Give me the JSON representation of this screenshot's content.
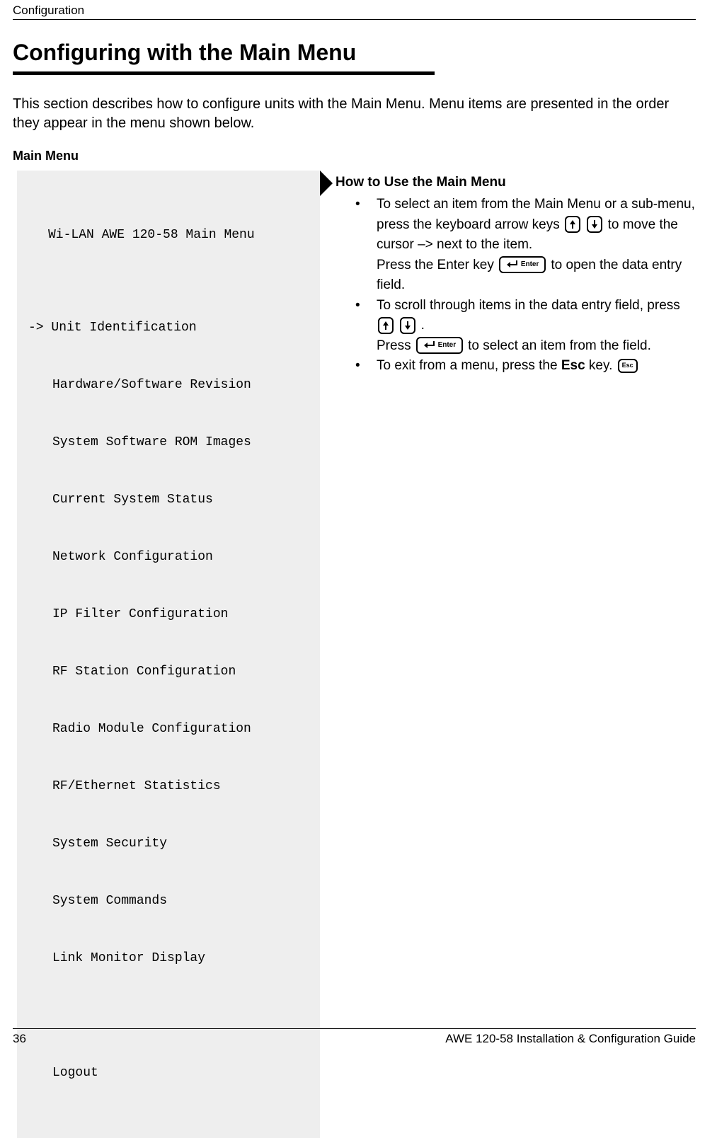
{
  "header": {
    "running": "Configuration"
  },
  "title": "Configuring with the Main Menu",
  "intro": "This section describes how to configure units with the Main Menu. Menu items are presented in the order they appear in the menu shown below.",
  "subhead": "Main Menu",
  "menu": {
    "title": "Wi-LAN AWE 120-58 Main Menu",
    "selected_index": 0,
    "items": [
      "Unit Identification",
      "Hardware/Software Revision",
      "System Software ROM Images",
      "Current System Status",
      "Network Configuration",
      "IP Filter Configuration",
      "RF Station Configuration",
      "Radio Module Configuration",
      "RF/Ethernet Statistics",
      "System Security",
      "System Commands",
      "Link Monitor Display"
    ],
    "logout": "Logout"
  },
  "howto": {
    "heading": "How to Use the Main Menu",
    "b1_a": "To select an item from the Main Menu or a sub-menu, press the keyboard arrow keys ",
    "b1_b": " to move the cursor –> next to the item.",
    "b1_c": "Press the ",
    "b1_enter_word": "Enter",
    "b1_d": " key ",
    "b1_e": " to open the data entry field.",
    "b2_a": "To scroll through items in the data entry field, press ",
    "b2_b": " .",
    "b2_c": "Press ",
    "b2_d": " to select an item from the field.",
    "b3_a": "To exit from a menu, press the ",
    "b3_esc_word": "Esc",
    "b3_b": " key. "
  },
  "keys": {
    "up": "↑",
    "down": "↓",
    "enter": "Enter",
    "esc": "Esc"
  },
  "footer": {
    "page": "36",
    "doc": "AWE 120-58 Installation & Configuration Guide"
  }
}
